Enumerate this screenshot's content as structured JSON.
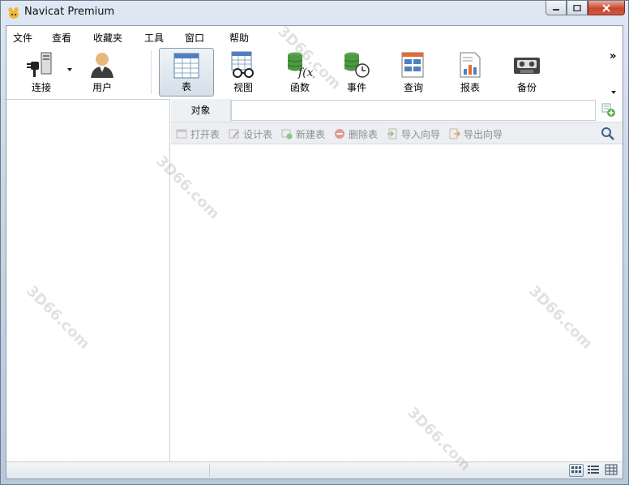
{
  "window": {
    "title": "Navicat Premium"
  },
  "menu": [
    "文件",
    "查看",
    "收藏夹",
    "工具",
    "窗口",
    "帮助"
  ],
  "toolbar": {
    "buttons": [
      {
        "label": "连接",
        "icon": "connection-plug-icon"
      },
      {
        "label": "用户",
        "icon": "user-icon"
      },
      {
        "label": "表",
        "icon": "table-icon",
        "active": true
      },
      {
        "label": "视图",
        "icon": "view-glasses-icon"
      },
      {
        "label": "函数",
        "icon": "function-fx-icon"
      },
      {
        "label": "事件",
        "icon": "event-clock-icon"
      },
      {
        "label": "查询",
        "icon": "query-icon"
      },
      {
        "label": "报表",
        "icon": "report-icon"
      },
      {
        "label": "备份",
        "icon": "backup-tape-icon"
      }
    ],
    "overflow": "»"
  },
  "object_panel": {
    "tab_label": "对象",
    "actions": [
      "打开表",
      "设计表",
      "新建表",
      "删除表",
      "导入向导",
      "导出向导"
    ]
  },
  "watermark": "3D66.com",
  "colors": {
    "accent": "#2e5f95",
    "title_bg": "#c9d6e4",
    "close_red": "#c7462f"
  }
}
